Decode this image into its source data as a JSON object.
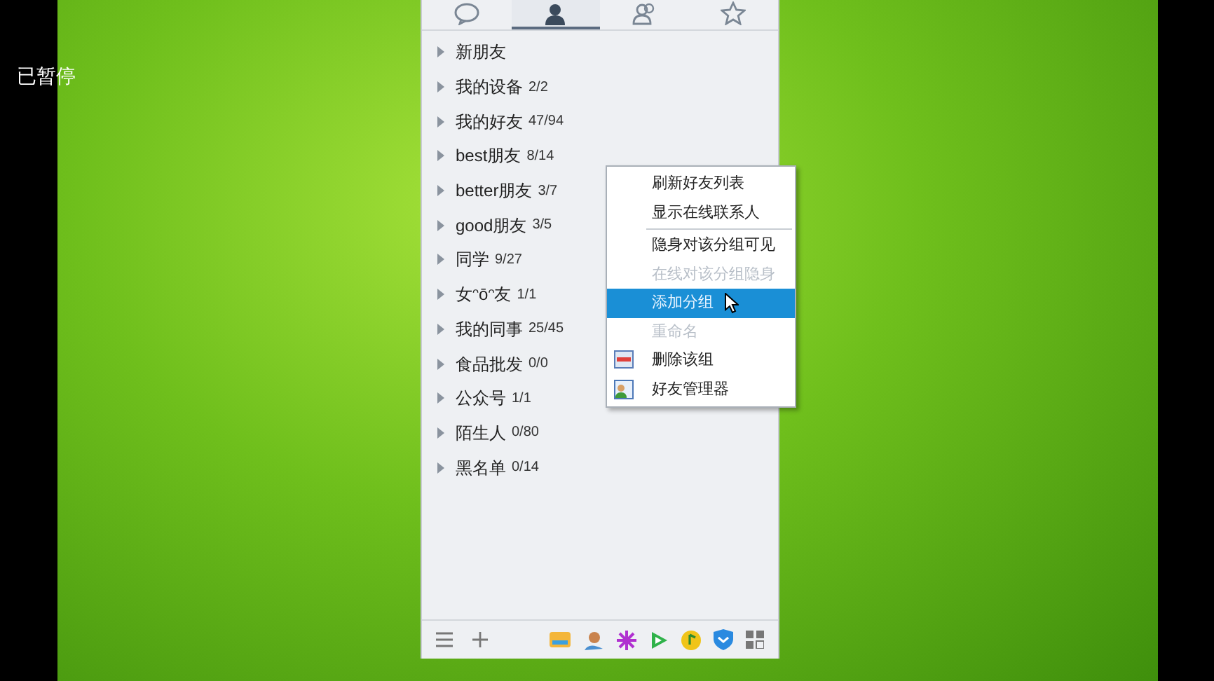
{
  "player_status": "已暂停",
  "tabs": [
    {
      "kind": "chat",
      "selected": false
    },
    {
      "kind": "contact",
      "selected": true
    },
    {
      "kind": "group",
      "selected": false
    },
    {
      "kind": "star",
      "selected": false
    }
  ],
  "groups": [
    {
      "name": "新朋友",
      "expanded": false
    },
    {
      "name": "我的设备",
      "count": "2/2",
      "expanded": false
    },
    {
      "name": "我的好友",
      "count": "47/94",
      "expanded": false
    },
    {
      "name": "best朋友",
      "count": "8/14",
      "expanded": false
    },
    {
      "name": "better朋友",
      "count": "3/7",
      "expanded": false
    },
    {
      "name": "good朋友",
      "count": "3/5",
      "expanded": false
    },
    {
      "name": "同学",
      "count": "9/27",
      "expanded": false
    },
    {
      "name": "女ᵔōᵔ友",
      "count": "1/1",
      "expanded": false
    },
    {
      "name": "我的同事",
      "count": "25/45",
      "expanded": false
    },
    {
      "name": "食品批发",
      "count": "0/0",
      "expanded": false
    },
    {
      "name": "公众号",
      "count": "1/1",
      "expanded": false
    },
    {
      "name": "陌生人",
      "count": "0/80",
      "expanded": false
    },
    {
      "name": "黑名单",
      "count": "0/14",
      "expanded": false
    }
  ],
  "context_menu": [
    {
      "label": "刷新好友列表",
      "disabled": false,
      "selected": false
    },
    {
      "label": "显示在线联系人",
      "disabled": false,
      "selected": false,
      "separator_after": true
    },
    {
      "label": "隐身对该分组可见",
      "disabled": false,
      "selected": false
    },
    {
      "label": "在线对该分组隐身",
      "disabled": true,
      "selected": false
    },
    {
      "label": "添加分组",
      "disabled": false,
      "selected": true
    },
    {
      "label": "重命名",
      "disabled": true,
      "selected": false
    },
    {
      "label": "删除该组",
      "disabled": false,
      "selected": false,
      "kind": "delete"
    },
    {
      "label": "好友管理器",
      "disabled": false,
      "selected": false,
      "kind": "manager"
    }
  ]
}
